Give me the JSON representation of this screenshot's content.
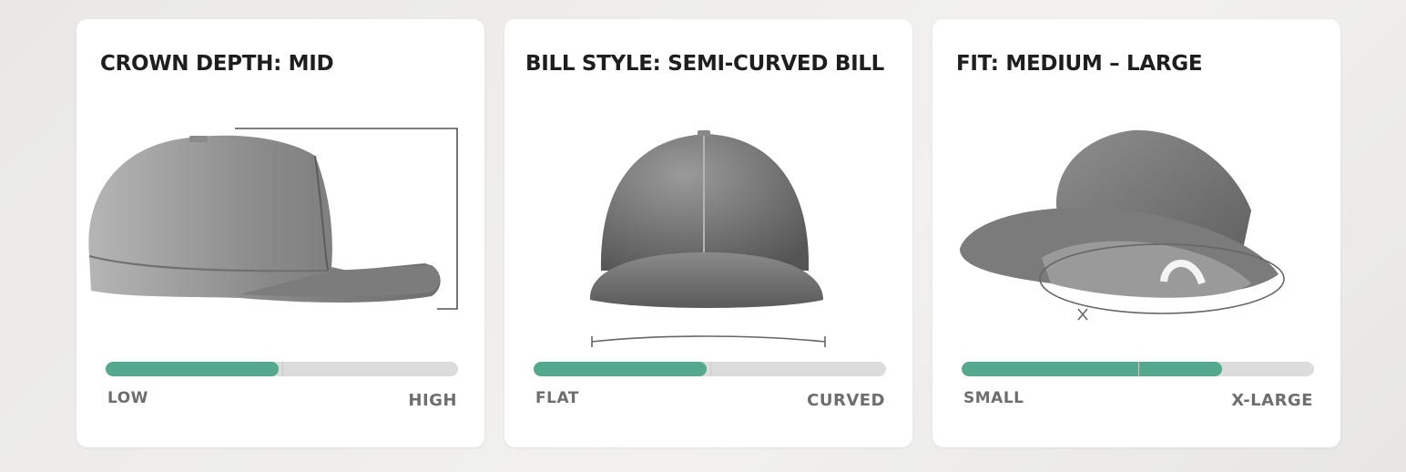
{
  "cards": [
    {
      "title": "CROWN DEPTH: MID",
      "image": "cap-side-view-with-depth-bracket",
      "scale": {
        "low_label": "LOW",
        "high_label": "HIGH",
        "level_fraction": 0.49
      }
    },
    {
      "title": "BILL STYLE: SEMI-CURVED BILL",
      "image": "cap-front-view-with-bill-curve",
      "scale": {
        "low_label": "FLAT",
        "high_label": "CURVED",
        "level_fraction": 0.49
      }
    },
    {
      "title": "FIT: MEDIUM – LARGE",
      "image": "cap-tilted-view-with-fit-ellipse",
      "scale": {
        "low_label": "SMALL",
        "high_label": "X-LARGE",
        "level_fraction": 0.74
      }
    }
  ],
  "colors": {
    "accent": "#52a98e",
    "track": "#dcdcdc",
    "card": "#ffffff"
  }
}
